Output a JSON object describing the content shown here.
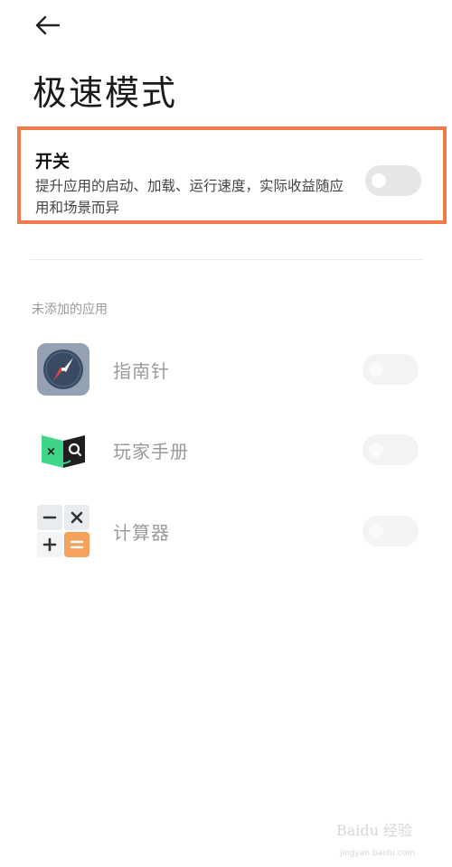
{
  "header": {
    "back_icon": "arrow-left-icon",
    "title": "极速模式"
  },
  "master_switch": {
    "title": "开关",
    "description": "提升应用的启动、加载、运行速度，实际收益随应用和场景而异",
    "enabled": false,
    "highlight_color": "#ee7b49"
  },
  "section": {
    "header": "未添加的应用"
  },
  "apps": [
    {
      "name": "指南针",
      "icon": "compass-icon",
      "enabled": false
    },
    {
      "name": "玩家手册",
      "icon": "player-handbook-icon",
      "enabled": false
    },
    {
      "name": "计算器",
      "icon": "calculator-icon",
      "enabled": false
    }
  ],
  "watermark": {
    "text": "Baidu 经验",
    "url": "jingyan.baidu.com"
  }
}
